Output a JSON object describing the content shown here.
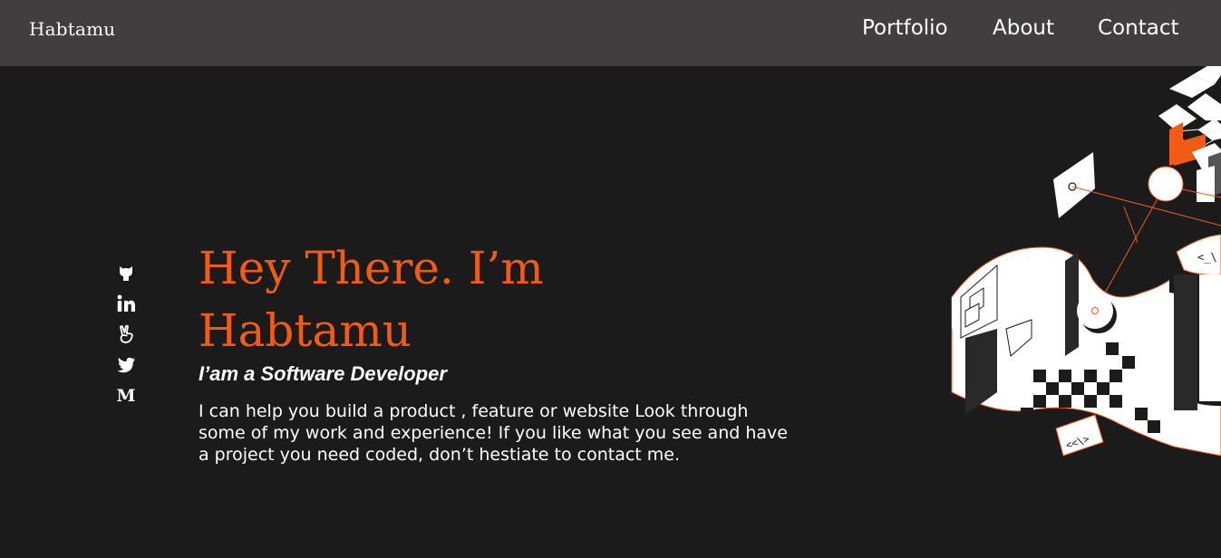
{
  "nav": {
    "brand": "Habtamu",
    "links": [
      "Portfolio",
      "About",
      "Contact"
    ]
  },
  "socials": [
    {
      "name": "github",
      "icon": "github-icon"
    },
    {
      "name": "linkedin",
      "icon": "linkedin-icon"
    },
    {
      "name": "angellist",
      "icon": "angellist-icon"
    },
    {
      "name": "twitter",
      "icon": "twitter-icon"
    },
    {
      "name": "medium",
      "icon": "medium-icon",
      "glyph": "M"
    }
  ],
  "hero": {
    "title_line1": "Hey There. I’m",
    "title_line2": "Habtamu",
    "subtitle": "I’am a Software Developer",
    "description": "I can help you build a product , feature or website Look through some of my work and experience! If you like what you see and have a project you need coded, don’t hestiate to contact me."
  },
  "illustration": {
    "code_tag_top": "<_\\",
    "code_tag_bottom": "<<\\>"
  },
  "colors": {
    "accent": "#f25b15",
    "background": "#1c1b1b",
    "navbar": "#403e3f",
    "text": "#ffffff"
  }
}
